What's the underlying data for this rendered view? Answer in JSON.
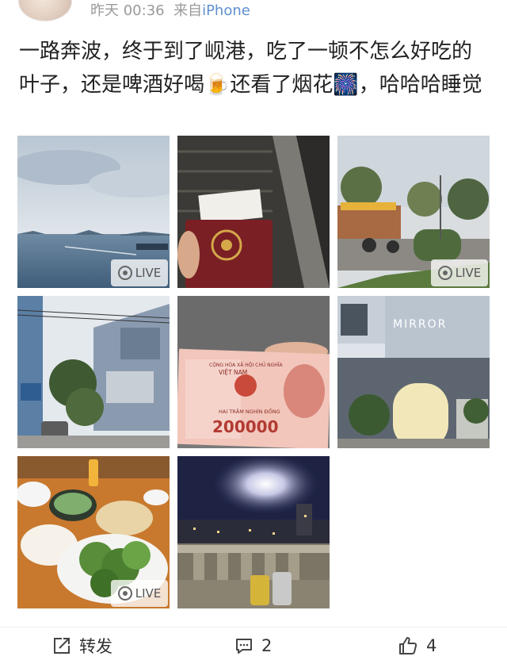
{
  "post": {
    "time": "昨天 00:36",
    "source_prefix": "来自",
    "source": "iPhone",
    "text": "一路奔波，终于到了岘港，吃了一顿不怎么好吃的叶子，还是啤酒好喝🍺还看了烟花🎆，哈哈哈睡觉"
  },
  "images": [
    {
      "name": "sea-photo",
      "live": true
    },
    {
      "name": "passport-escalator-photo",
      "live": false
    },
    {
      "name": "street-photo",
      "live": true
    },
    {
      "name": "building-street-photo",
      "live": false
    },
    {
      "name": "banknote-photo",
      "live": false
    },
    {
      "name": "mirror-cafe-photo",
      "live": false
    },
    {
      "name": "food-table-photo",
      "live": true
    },
    {
      "name": "fireworks-night-photo",
      "live": false
    }
  ],
  "live_label": "LIVE",
  "photo_text": {
    "banknote_header": "CỘNG HÒA XÃ HỘI CHỦ NGHĨA",
    "banknote_country": "VIỆT NAM",
    "banknote_words": "HAI TRĂM NGHÌN ĐỒNG",
    "banknote_value": "200000",
    "cafe_name": "MIRROR"
  },
  "actions": {
    "repost_label": "转发",
    "comment_count": "2",
    "like_count": "4"
  },
  "colors": {
    "meta_gray": "#9a9a9a",
    "source_blue": "#5f8fd0",
    "text": "#222222"
  }
}
